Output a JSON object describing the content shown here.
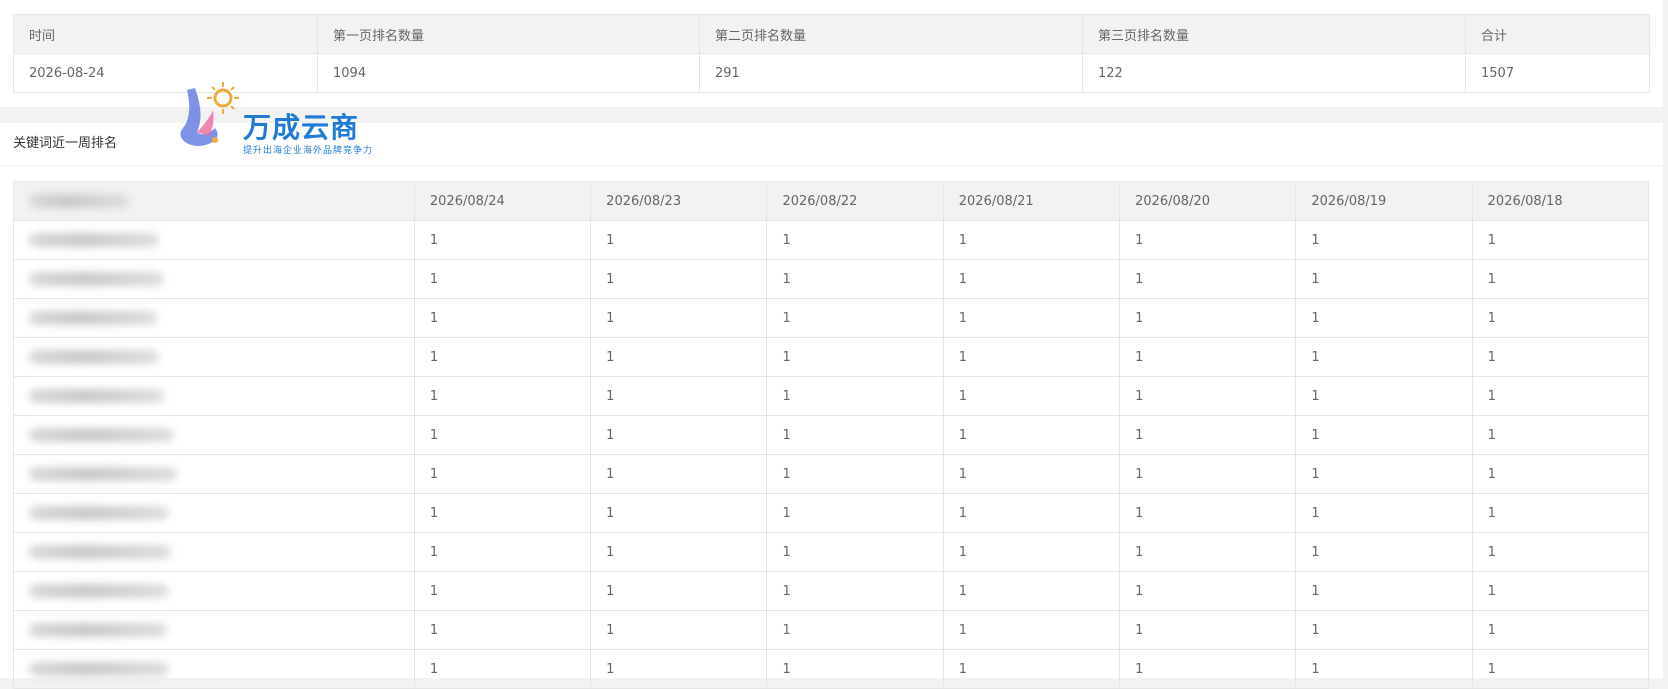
{
  "summary": {
    "headers": [
      "时间",
      "第一页排名数量",
      "第二页排名数量",
      "第三页排名数量",
      "合计"
    ],
    "row": [
      "2026-08-24",
      "1094",
      "291",
      "122",
      "1507"
    ]
  },
  "weekly": {
    "title": "关键词近一周排名",
    "dates": [
      "2026/08/24",
      "2026/08/23",
      "2026/08/22",
      "2026/08/21",
      "2026/08/20",
      "2026/08/19",
      "2026/08/18"
    ],
    "rows": [
      [
        "1",
        "1",
        "1",
        "1",
        "1",
        "1",
        "1"
      ],
      [
        "1",
        "1",
        "1",
        "1",
        "1",
        "1",
        "1"
      ],
      [
        "1",
        "1",
        "1",
        "1",
        "1",
        "1",
        "1"
      ],
      [
        "1",
        "1",
        "1",
        "1",
        "1",
        "1",
        "1"
      ],
      [
        "1",
        "1",
        "1",
        "1",
        "1",
        "1",
        "1"
      ],
      [
        "1",
        "1",
        "1",
        "1",
        "1",
        "1",
        "1"
      ],
      [
        "1",
        "1",
        "1",
        "1",
        "1",
        "1",
        "1"
      ],
      [
        "1",
        "1",
        "1",
        "1",
        "1",
        "1",
        "1"
      ],
      [
        "1",
        "1",
        "1",
        "1",
        "1",
        "1",
        "1"
      ],
      [
        "1",
        "1",
        "1",
        "1",
        "1",
        "1",
        "1"
      ],
      [
        "1",
        "1",
        "1",
        "1",
        "1",
        "1",
        "1"
      ],
      [
        "1",
        "1",
        "1",
        "1",
        "1",
        "1",
        "1"
      ]
    ]
  },
  "watermark": {
    "name": "万成云商",
    "tagline": "提升出海企业海外品牌竞争力"
  }
}
